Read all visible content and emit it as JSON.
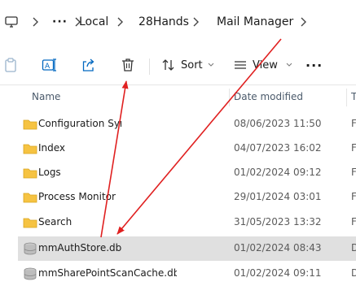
{
  "breadcrumb": {
    "icon": "monitor-icon",
    "more": "···",
    "items": [
      "Local",
      "28Hands",
      "Mail Manager"
    ]
  },
  "toolbar": {
    "sort_label": "Sort",
    "view_label": "View",
    "more_label": "···"
  },
  "columns": {
    "name": "Name",
    "date": "Date modified",
    "type": "T"
  },
  "rows": [
    {
      "name": "Configuration Sync",
      "date": "08/06/2023 11:50",
      "type": "F",
      "icon": "folder-icon"
    },
    {
      "name": "Index",
      "date": "04/07/2023 16:02",
      "type": "F",
      "icon": "folder-icon"
    },
    {
      "name": "Logs",
      "date": "01/02/2024 09:12",
      "type": "F",
      "icon": "folder-icon"
    },
    {
      "name": "Process Monitor",
      "date": "29/01/2024 03:01",
      "type": "F",
      "icon": "folder-icon"
    },
    {
      "name": "Search",
      "date": "31/05/2023 13:32",
      "type": "F",
      "icon": "folder-icon"
    },
    {
      "name": "mmAuthStore.db",
      "date": "01/02/2024 08:43",
      "type": "D",
      "icon": "database-file-icon"
    },
    {
      "name": "mmSharePointScanCache.db",
      "date": "01/02/2024 09:11",
      "type": "D",
      "icon": "database-file-icon"
    }
  ],
  "colors": {
    "accent": "#0067c0",
    "folder": "#f6c342",
    "annotation": "#e02020",
    "selected_row": "#e0e0e0"
  }
}
